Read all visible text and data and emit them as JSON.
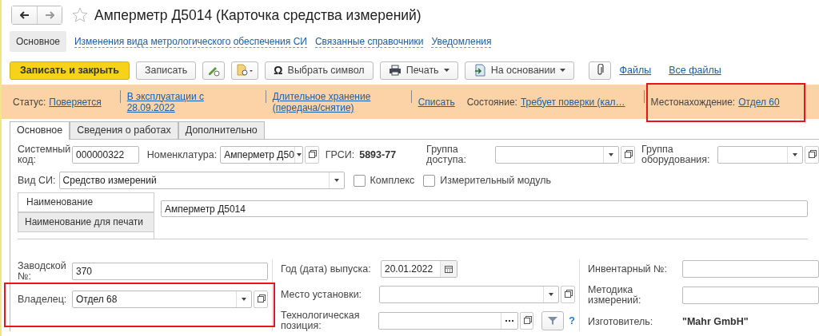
{
  "window": {
    "title": "Амперметр Д5014 (Карточка средства измерений)"
  },
  "section_tabs": [
    {
      "label": "Основное",
      "selected": true
    },
    {
      "label": "Изменения вида метрологического обеспечения СИ",
      "selected": false
    },
    {
      "label": "Связанные справочники",
      "selected": false
    },
    {
      "label": "Уведомления",
      "selected": false
    }
  ],
  "toolbar": {
    "save_close": "Записать и закрыть",
    "save": "Записать",
    "symbol_icon": "Ω",
    "symbol": "Выбрать символ",
    "print": "Печать",
    "based_on": "На основании",
    "files": "Файлы",
    "all_files": "Все файлы"
  },
  "status_bar": [
    {
      "label": "Статус:",
      "link": "Поверяется",
      "divider_after": true
    },
    {
      "link": "В эксплуатации с 28.09.2022",
      "divider_after": true
    },
    {
      "link": "Длительное хранение (передача/снятие)",
      "divider_after": true
    },
    {
      "link": "Списать",
      "divider_after": false
    },
    {
      "label": "Состояние:",
      "link": "Требует поверки (кал…",
      "divider_after": true
    },
    {
      "label": "Местонахождение:",
      "link": "Отдел 60",
      "divider_after": false
    }
  ],
  "form_tabs": [
    {
      "label": "Основное",
      "selected": true
    },
    {
      "label": "Сведения о работах",
      "selected": false
    },
    {
      "label": "Дополнительно",
      "selected": false
    }
  ],
  "system_code": {
    "label": "Системный код:",
    "value": "000000322"
  },
  "nomenclature": {
    "label": "Номенклатура:",
    "value": "Амперметр Д50"
  },
  "grsi": {
    "label": "ГРСИ:",
    "value": "5893-77"
  },
  "access_group": {
    "label": "Группа доступа:"
  },
  "equipment_group": {
    "label": "Группа оборудования:"
  },
  "si_type": {
    "label": "Вид СИ:",
    "value": "Средство измерений"
  },
  "checkboxes": [
    {
      "label": "Комплекс",
      "checked": false
    },
    {
      "label": "Измерительный модуль",
      "checked": false
    }
  ],
  "name_tabs": [
    {
      "label": "Наименование",
      "selected": true
    },
    {
      "label": "Наименование для печати",
      "selected": false
    }
  ],
  "name_value": "Амперметр Д5014",
  "serial": {
    "label": "Заводской №:",
    "value": "370"
  },
  "owner": {
    "label": "Владелец:",
    "value": "Отдел 68"
  },
  "release_date": {
    "label": "Год (дата) выпуска:",
    "value": "20.01.2022"
  },
  "install_place": {
    "label": "Место установки:"
  },
  "tech_position": {
    "label": "Технологическая позиция:",
    "help": "?"
  },
  "inventory": {
    "label": "Инвентарный №:"
  },
  "method": {
    "label": "Методика измерений:"
  },
  "manufacturer": {
    "label": "Изготовитель:",
    "value": "\"Mahr GmbH\""
  }
}
